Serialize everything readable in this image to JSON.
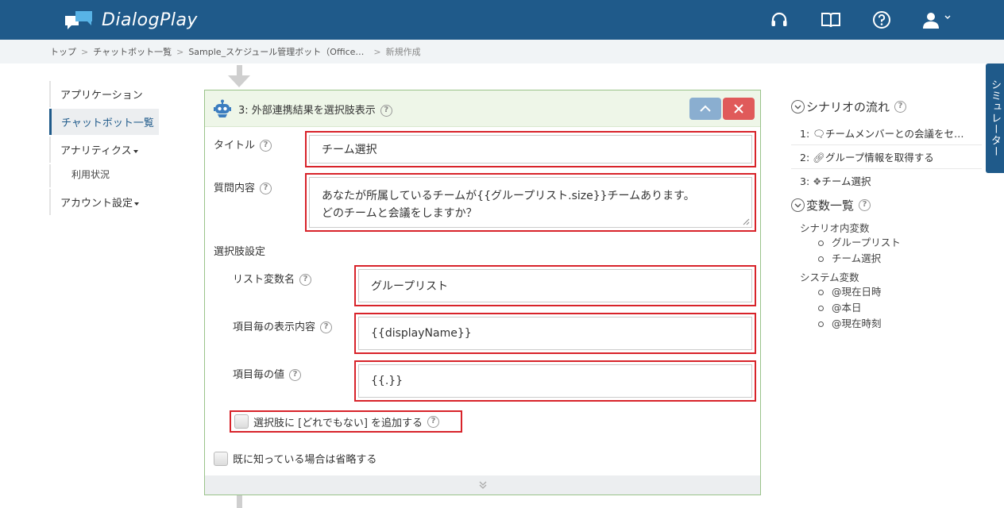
{
  "header": {
    "app_name": "DialogPlay",
    "icons": [
      "headset-icon",
      "book-icon",
      "help-icon",
      "user-icon"
    ]
  },
  "breadcrumb": {
    "items": [
      "トップ",
      "チャットボット一覧",
      "Sample_スケジュール管理ボット（Office…",
      "新規作成"
    ]
  },
  "sidebar": {
    "items": [
      {
        "label": "アプリケーション"
      },
      {
        "label": "チャットボット一覧"
      },
      {
        "label": "アナリティクス"
      },
      {
        "label": "利用状況"
      },
      {
        "label": "アカウント設定"
      }
    ]
  },
  "card": {
    "title": "3: 外部連携結果を選択肢表示",
    "title_label": "タイトル",
    "title_value": "チーム選択",
    "question_label": "質問内容",
    "question_line1": "あなたが所属しているチームが{{グループリスト.size}}チームあります。",
    "question_line2": "どのチームと会議をしますか？",
    "choice_settings_label": "選択肢設定",
    "list_var_label": "リスト変数名",
    "list_var_value": "グループリスト",
    "display_label": "項目毎の表示内容",
    "display_value": "{{displayName}}",
    "value_label": "項目毎の値",
    "value_value": "{{.}}",
    "add_none_label": "選択肢に [どれでもない] を追加する",
    "skip_label": "既に知っている場合は省略する"
  },
  "right_panel": {
    "flow_heading": "シナリオの流れ",
    "flow_items": [
      {
        "num": "1:",
        "label": "チームメンバーとの会議をセ…"
      },
      {
        "num": "2:",
        "label": "グループ情報を取得する"
      },
      {
        "num": "3:",
        "label": "チーム選択"
      }
    ],
    "vars_heading": "変数一覧",
    "scenario_vars_label": "シナリオ内変数",
    "scenario_vars": [
      "グループリスト",
      "チーム選択"
    ],
    "system_vars_label": "システム変数",
    "system_vars": [
      "@現在日時",
      "@本日",
      "@現在時刻"
    ]
  },
  "simulator_tab": "シミュレーター",
  "colors": {
    "header_bg": "#1f5a8a",
    "highlight_border": "#d8232a",
    "card_border": "#9ac38a",
    "close_button": "#e05a5a",
    "up_button": "#8aaed0"
  }
}
